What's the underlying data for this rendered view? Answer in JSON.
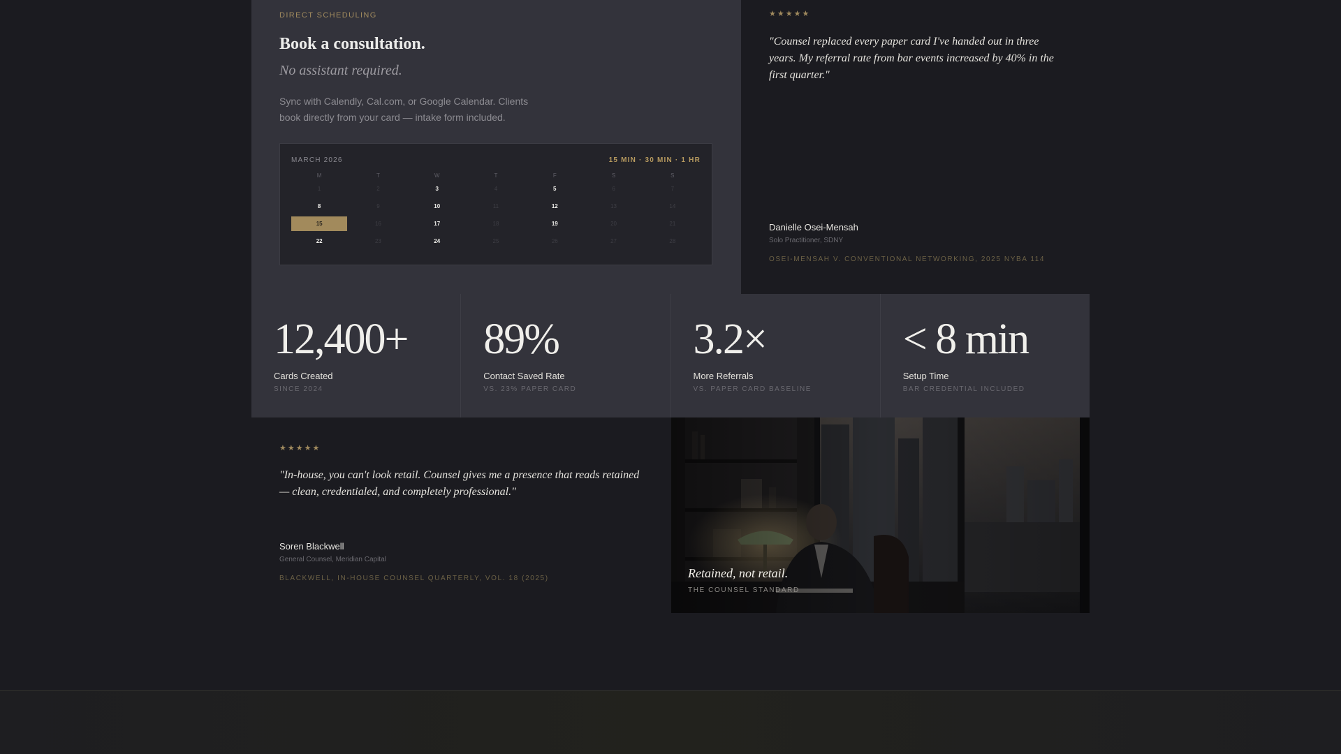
{
  "scheduling": {
    "eyebrow": "DIRECT SCHEDULING",
    "title": "Book a consultation.",
    "subtitle": "No assistant required.",
    "description": "Sync with Calendly, Cal.com, or Google Calendar. Clients book directly from your card — intake form included.",
    "calendar": {
      "month": "MARCH 2026",
      "durations": "15 MIN · 30 MIN · 1 HR",
      "weekdays": [
        "M",
        "T",
        "W",
        "T",
        "F",
        "S",
        "S"
      ],
      "days": [
        {
          "label": "1",
          "state": "unavailable"
        },
        {
          "label": "2",
          "state": "unavailable"
        },
        {
          "label": "3",
          "state": "available"
        },
        {
          "label": "4",
          "state": "unavailable"
        },
        {
          "label": "5",
          "state": "available"
        },
        {
          "label": "6",
          "state": "unavailable"
        },
        {
          "label": "7",
          "state": "unavailable"
        },
        {
          "label": "8",
          "state": "available"
        },
        {
          "label": "9",
          "state": "unavailable"
        },
        {
          "label": "10",
          "state": "available"
        },
        {
          "label": "11",
          "state": "unavailable"
        },
        {
          "label": "12",
          "state": "available"
        },
        {
          "label": "13",
          "state": "unavailable"
        },
        {
          "label": "14",
          "state": "unavailable"
        },
        {
          "label": "15",
          "state": "selected"
        },
        {
          "label": "16",
          "state": "unavailable"
        },
        {
          "label": "17",
          "state": "available"
        },
        {
          "label": "18",
          "state": "unavailable"
        },
        {
          "label": "19",
          "state": "available"
        },
        {
          "label": "20",
          "state": "unavailable"
        },
        {
          "label": "21",
          "state": "unavailable"
        },
        {
          "label": "22",
          "state": "available"
        },
        {
          "label": "23",
          "state": "unavailable"
        },
        {
          "label": "24",
          "state": "available"
        },
        {
          "label": "25",
          "state": "unavailable"
        },
        {
          "label": "26",
          "state": "unavailable"
        },
        {
          "label": "27",
          "state": "unavailable"
        },
        {
          "label": "28",
          "state": "unavailable"
        }
      ]
    }
  },
  "testimonial_1": {
    "stars": "★★★★★",
    "quote": "\"Counsel replaced every paper card I've handed out in three years. My referral rate from bar events increased by 40% in the first quarter.\"",
    "author": "Danielle Osei-Mensah",
    "role": "Solo Practitioner, SDNY",
    "citation": "OSEI-MENSAH V. CONVENTIONAL NETWORKING, 2025 NYBA 114"
  },
  "stats": [
    {
      "value": "12,400+",
      "label": "Cards Created",
      "sub": "SINCE 2024"
    },
    {
      "value": "89%",
      "label": "Contact Saved Rate",
      "sub": "VS. 23% PAPER CARD"
    },
    {
      "value": "3.2×",
      "label": "More Referrals",
      "sub": "VS. PAPER CARD BASELINE"
    },
    {
      "value": "< 8 min",
      "label": "Setup Time",
      "sub": "BAR CREDENTIAL INCLUDED"
    }
  ],
  "testimonial_2": {
    "stars": "★★★★★",
    "quote": "\"In-house, you can't look retail. Counsel gives me a presence that reads retained — clean, credentialed, and completely professional.\"",
    "author": "Soren Blackwell",
    "role": "General Counsel, Meridian Capital",
    "citation": "BLACKWELL, IN-HOUSE COUNSEL QUARTERLY, VOL. 18 (2025)"
  },
  "photo": {
    "caption": "Retained, not retail.",
    "credit": "THE COUNSEL STANDARD"
  },
  "colors": {
    "accent_gold": "#a28a5c",
    "panel": "#33333b",
    "background": "#1b1b20"
  }
}
